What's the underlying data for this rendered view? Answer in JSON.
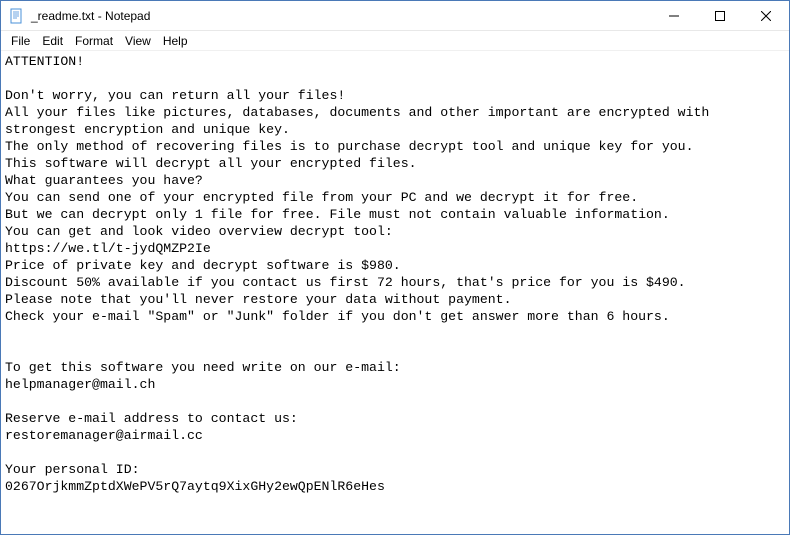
{
  "window": {
    "title": "_readme.txt - Notepad"
  },
  "menu": {
    "file": "File",
    "edit": "Edit",
    "format": "Format",
    "view": "View",
    "help": "Help"
  },
  "body": {
    "text": "ATTENTION!\n\nDon't worry, you can return all your files!\nAll your files like pictures, databases, documents and other important are encrypted with strongest encryption and unique key.\nThe only method of recovering files is to purchase decrypt tool and unique key for you.\nThis software will decrypt all your encrypted files.\nWhat guarantees you have?\nYou can send one of your encrypted file from your PC and we decrypt it for free.\nBut we can decrypt only 1 file for free. File must not contain valuable information.\nYou can get and look video overview decrypt tool:\nhttps://we.tl/t-jydQMZP2Ie\nPrice of private key and decrypt software is $980.\nDiscount 50% available if you contact us first 72 hours, that's price for you is $490.\nPlease note that you'll never restore your data without payment.\nCheck your e-mail \"Spam\" or \"Junk\" folder if you don't get answer more than 6 hours.\n\n\nTo get this software you need write on our e-mail:\nhelpmanager@mail.ch\n\nReserve e-mail address to contact us:\nrestoremanager@airmail.cc\n\nYour personal ID:\n0267OrjkmmZptdXWePV5rQ7aytq9XixGHy2ewQpENlR6eHes"
  }
}
